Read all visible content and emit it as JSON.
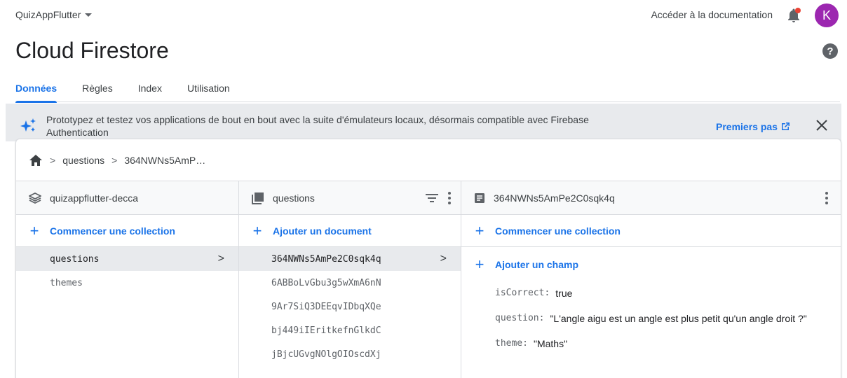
{
  "topbar": {
    "project": "QuizAppFlutter",
    "doc_link": "Accéder à la documentation",
    "avatar_letter": "K"
  },
  "title": "Cloud Firestore",
  "tabs": [
    {
      "label": "Données",
      "active": true
    },
    {
      "label": "Règles",
      "active": false
    },
    {
      "label": "Index",
      "active": false
    },
    {
      "label": "Utilisation",
      "active": false
    }
  ],
  "banner": {
    "text": "Prototypez et testez vos applications de bout en bout avec la suite d'émulateurs locaux, désormais compatible avec Firebase Authentication",
    "link": "Premiers pas"
  },
  "breadcrumb": [
    "questions",
    "364NWNs5AmP…"
  ],
  "col1": {
    "header": "quizappflutter-decca",
    "action": "Commencer une collection",
    "items": [
      "questions",
      "themes"
    ]
  },
  "col2": {
    "header": "questions",
    "action": "Ajouter un document",
    "items": [
      "364NWNs5AmPe2C0sqk4q",
      "6ABBoLvGbu3g5wXmA6nN",
      "9Ar7SiQ3DEEqvIDbqXQe",
      "bj449iIEritkefnGlkdC",
      "jBjcUGvgNOlgOIOscdXj"
    ]
  },
  "col3": {
    "header": "364NWNs5AmPe2C0sqk4q",
    "action": "Commencer une collection",
    "add_field": "Ajouter un champ",
    "fields": [
      {
        "key": "isCorrect:",
        "value": "true"
      },
      {
        "key": "question:",
        "value": "\"L'angle aigu est un angle est plus petit qu'un angle droit ?\""
      },
      {
        "key": "theme:",
        "value": "\"Maths\""
      }
    ]
  },
  "colors": {
    "accent": "#1a73e8",
    "avatar": "#9c27b0",
    "notification": "#ea4335"
  }
}
